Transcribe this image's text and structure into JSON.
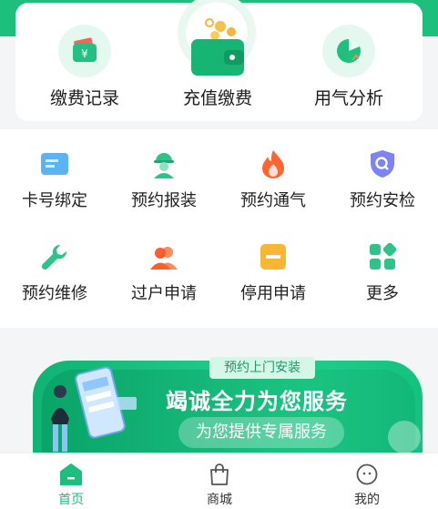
{
  "top_actions": [
    {
      "label": "缴费记录",
      "icon": "payment-record-icon"
    },
    {
      "label": "充值缴费",
      "icon": "wallet-icon"
    },
    {
      "label": "用气分析",
      "icon": "pie-chart-icon"
    }
  ],
  "services": [
    {
      "label": "卡号绑定",
      "icon": "card-icon"
    },
    {
      "label": "预约报装",
      "icon": "worker-icon"
    },
    {
      "label": "预约通气",
      "icon": "flame-icon"
    },
    {
      "label": "预约安检",
      "icon": "shield-search-icon"
    },
    {
      "label": "预约维修",
      "icon": "wrench-icon"
    },
    {
      "label": "过户申请",
      "icon": "users-icon"
    },
    {
      "label": "停用申请",
      "icon": "stop-icon"
    },
    {
      "label": "更多",
      "icon": "grid-icon"
    }
  ],
  "banner": {
    "tag": "预约上门安装",
    "title": "竭诚全力为您服务",
    "subtitle": "为您提供专属服务"
  },
  "tabbar": [
    {
      "label": "首页",
      "icon": "home-icon",
      "active": true
    },
    {
      "label": "商城",
      "icon": "bag-icon",
      "active": false
    },
    {
      "label": "我的",
      "icon": "profile-icon",
      "active": false
    }
  ],
  "colors": {
    "brand": "#1dbf7c",
    "icon_blue": "#4aa8f0",
    "icon_green": "#2dc489",
    "icon_orange": "#ff6b3d",
    "icon_purple": "#7a7ff2",
    "icon_yellow": "#f7b733"
  }
}
